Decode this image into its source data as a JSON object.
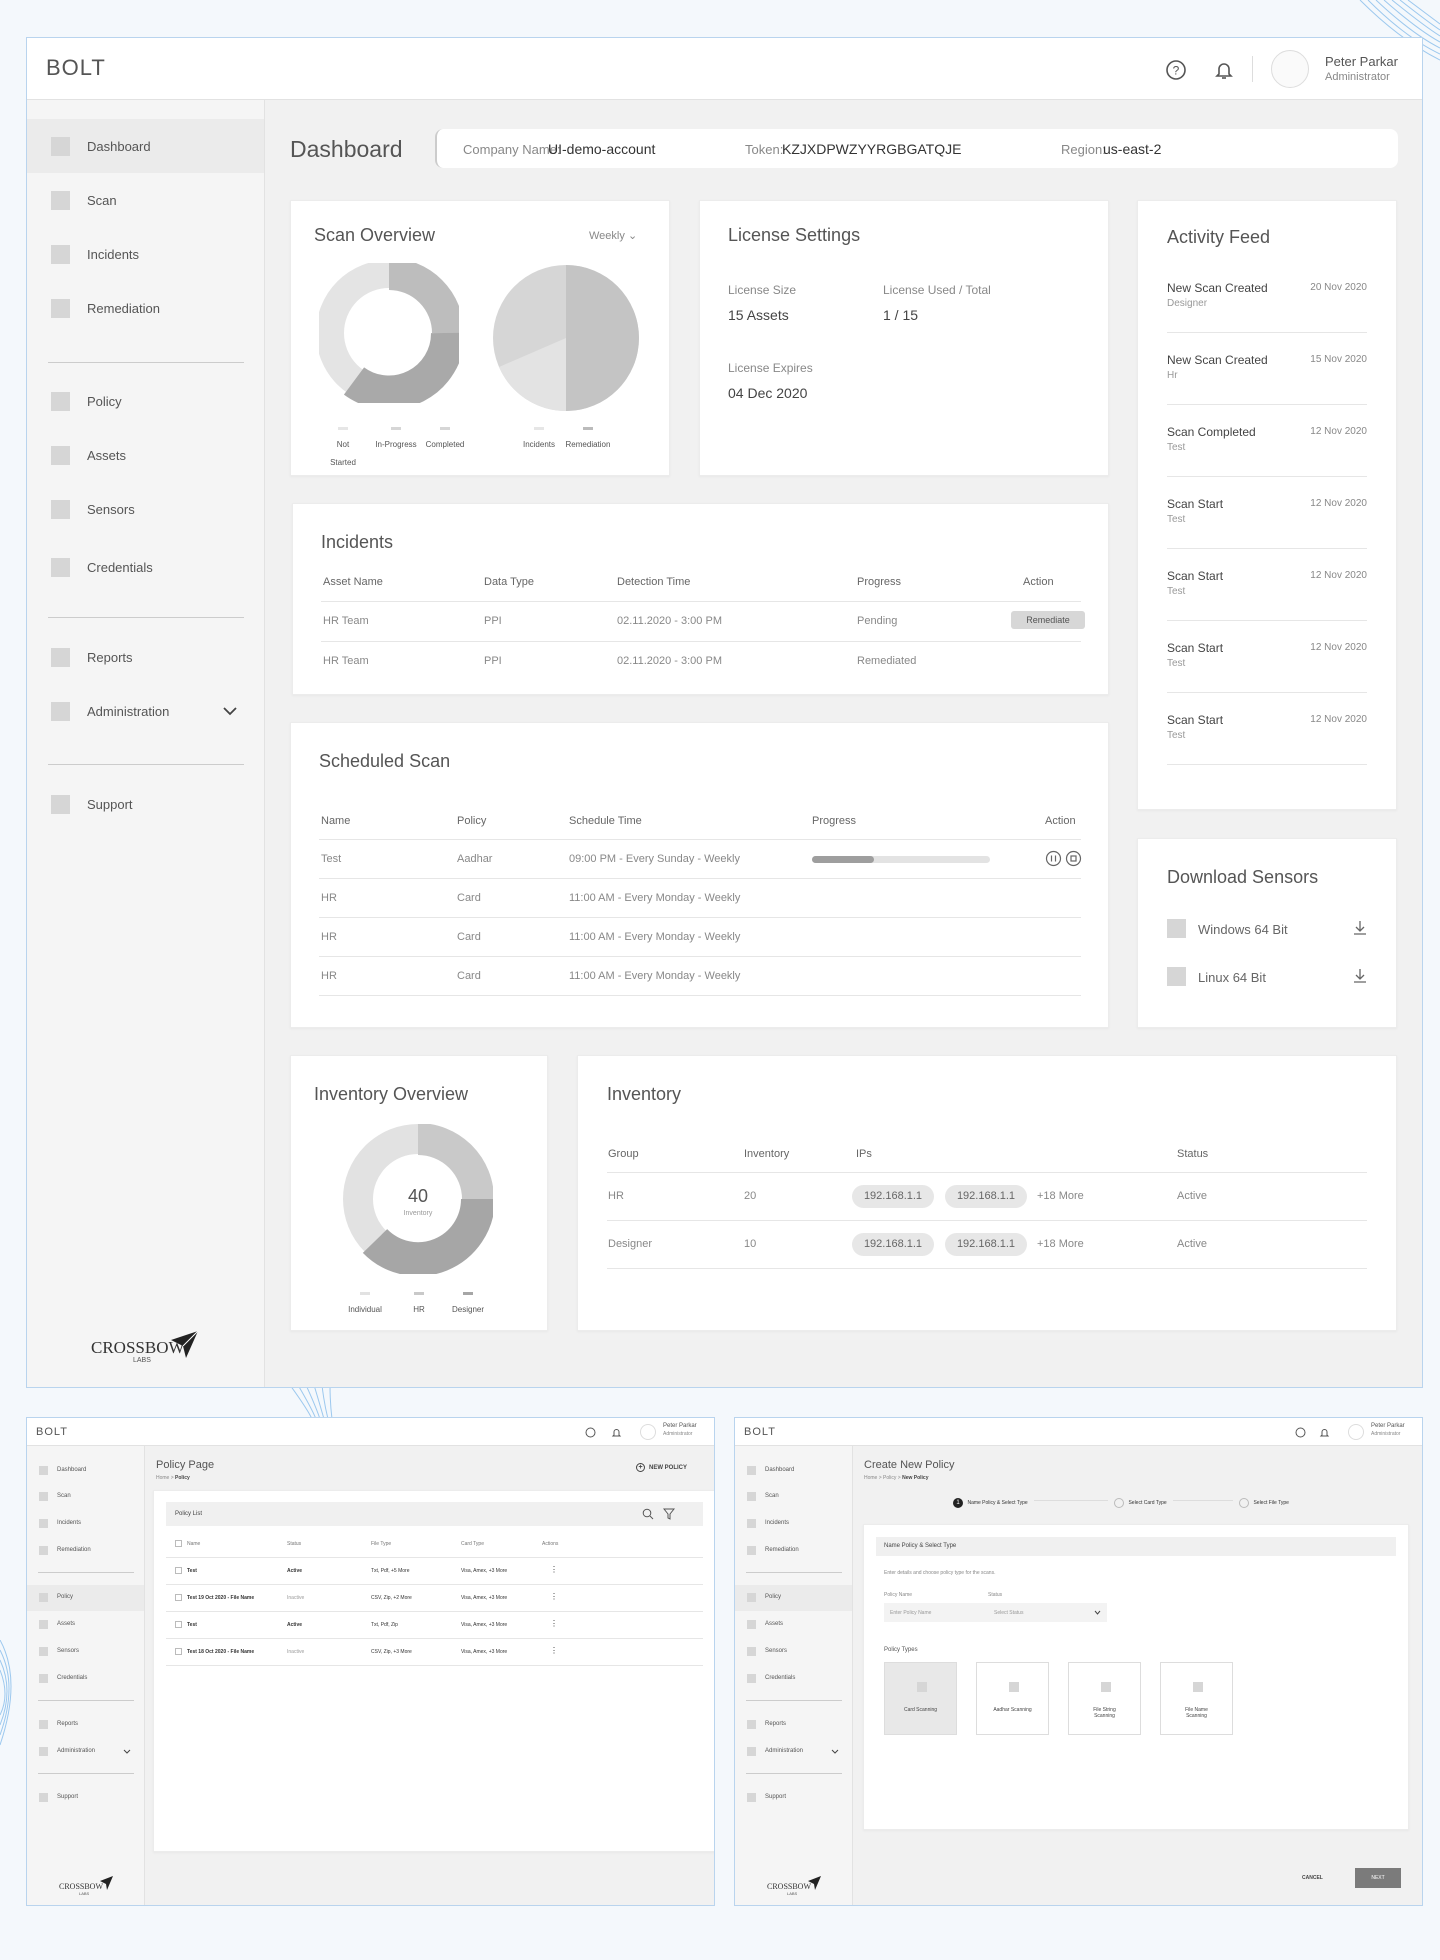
{
  "app": {
    "name": "BOLT",
    "brand": "CROSSBOW",
    "brand_sub": "LABS"
  },
  "user": {
    "name": "Peter Parkar",
    "role": "Administrator"
  },
  "sidebar": {
    "items": [
      {
        "label": "Dashboard"
      },
      {
        "label": "Scan"
      },
      {
        "label": "Incidents"
      },
      {
        "label": "Remediation"
      },
      {
        "label": "Policy"
      },
      {
        "label": "Assets"
      },
      {
        "label": "Sensors"
      },
      {
        "label": "Credentials"
      },
      {
        "label": "Reports"
      },
      {
        "label": "Administration"
      },
      {
        "label": "Support"
      }
    ]
  },
  "header": {
    "title": "Dashboard",
    "company_label": "Company Name:",
    "company": "UI-demo-account",
    "token_label": "Token:",
    "token": "KZJXDPWZYYRGBGATQJE",
    "region_label": "Region:",
    "region": "us-east-2"
  },
  "scan_overview": {
    "title": "Scan Overview",
    "period": "Weekly",
    "legend1": [
      "Not Started",
      "In-Progress",
      "Completed"
    ],
    "legend2": [
      "Incidents",
      "Remediation"
    ]
  },
  "license": {
    "title": "License Settings",
    "size_label": "License Size",
    "size": "15 Assets",
    "used_label": "License Used / Total",
    "used": "1 / 15",
    "expires_label": "License Expires",
    "expires": "04 Dec 2020"
  },
  "activity": {
    "title": "Activity Feed",
    "items": [
      {
        "title": "New Scan Created",
        "sub": "Designer",
        "date": "20 Nov 2020"
      },
      {
        "title": "New Scan Created",
        "sub": "Hr",
        "date": "15 Nov 2020"
      },
      {
        "title": "Scan Completed",
        "sub": "Test",
        "date": "12 Nov 2020"
      },
      {
        "title": "Scan Start",
        "sub": "Test",
        "date": "12 Nov 2020"
      },
      {
        "title": "Scan Start",
        "sub": "Test",
        "date": "12 Nov 2020"
      },
      {
        "title": "Scan Start",
        "sub": "Test",
        "date": "12 Nov 2020"
      },
      {
        "title": "Scan Start",
        "sub": "Test",
        "date": "12 Nov 2020"
      }
    ]
  },
  "incidents": {
    "title": "Incidents",
    "columns": [
      "Asset Name",
      "Data Type",
      "Detection Time",
      "Progress",
      "Action"
    ],
    "rows": [
      {
        "asset": "HR Team",
        "type": "PPI",
        "time": "02.11.2020 - 3:00 PM",
        "progress": "Pending",
        "action": "Remediate"
      },
      {
        "asset": "HR Team",
        "type": "PPI",
        "time": "02.11.2020 - 3:00 PM",
        "progress": "Remediated",
        "action": ""
      }
    ]
  },
  "scheduled": {
    "title": "Scheduled Scan",
    "columns": [
      "Name",
      "Policy",
      "Schedule Time",
      "Progress",
      "Action"
    ],
    "rows": [
      {
        "name": "Test",
        "policy": "Aadhar",
        "time": "09:00 PM - Every Sunday - Weekly",
        "progress": 0.35
      },
      {
        "name": "HR",
        "policy": "Card",
        "time": "11:00 AM - Every Monday - Weekly"
      },
      {
        "name": "HR",
        "policy": "Card",
        "time": "11:00 AM - Every Monday - Weekly"
      },
      {
        "name": "HR",
        "policy": "Card",
        "time": "11:00 AM - Every Monday - Weekly"
      }
    ]
  },
  "sensors": {
    "title": "Download Sensors",
    "items": [
      {
        "label": "Windows 64 Bit"
      },
      {
        "label": "Linux 64 Bit"
      }
    ]
  },
  "inventory_overview": {
    "title": "Inventory Overview",
    "value": "40",
    "value_label": "Inventory",
    "legend": [
      "Individual",
      "HR",
      "Designer"
    ]
  },
  "inventory": {
    "title": "Inventory",
    "columns": [
      "Group",
      "Inventory",
      "IPs",
      "Status"
    ],
    "rows": [
      {
        "group": "HR",
        "count": "20",
        "ip1": "192.168.1.1",
        "ip2": "192.168.1.1",
        "more": "+18 More",
        "status": "Active"
      },
      {
        "group": "Designer",
        "count": "10",
        "ip1": "192.168.1.1",
        "ip2": "192.168.1.1",
        "more": "+18 More",
        "status": "Active"
      }
    ]
  },
  "policy_page": {
    "title": "Policy Page",
    "crumb_home": "Home",
    "crumb_sep": " > ",
    "crumb_current": "Policy",
    "new_button": "NEW POLICY",
    "list_title": "Policy List",
    "columns": [
      "Name",
      "Status",
      "File Type",
      "Card Type",
      "Actions"
    ],
    "rows": [
      {
        "name": "Test",
        "status": "Active",
        "file": "Txt, Pdf, +5 More",
        "card": "Visa, Amex, +3 More"
      },
      {
        "name": "Test 19 Oct 2020 - File Name",
        "status": "Inactive",
        "file": "CSV, Zip, +2 More",
        "card": "Visa, Amex, +3 More"
      },
      {
        "name": "Test",
        "status": "Active",
        "file": "Txt, Pdf, Zip",
        "card": "Visa, Amex, +3 More"
      },
      {
        "name": "Test 18 Oct 2020 - File Name",
        "status": "Inactive",
        "file": "CSV, Zip, +3 More",
        "card": "Visa, Amex, +3 More"
      }
    ]
  },
  "new_policy": {
    "title": "Create New Policy",
    "crumb_home": "Home",
    "crumb_mid": "Policy",
    "crumb_current": "New Policy",
    "steps": [
      "Name Policy & Select Type",
      "Select Card Type",
      "Select File Type"
    ],
    "step_active": "1",
    "section_title": "Name Policy & Select Type",
    "section_desc": "Enter details and choose policy type for the scans.",
    "name_label": "Policy Name",
    "name_placeholder": "Enter Policy Name",
    "status_label": "Status",
    "status_placeholder": "Select Status",
    "types_label": "Policy Types",
    "types": [
      "Card Scanning",
      "Aadhar Scanning",
      "File String Scanning",
      "File Name Scanning"
    ],
    "cancel": "CANCEL",
    "next": "NEXT"
  },
  "colors": {
    "frame_border": "#b9d4ee",
    "accent_line": "#9fc6ea",
    "button_dark": "#7b7b7b"
  }
}
